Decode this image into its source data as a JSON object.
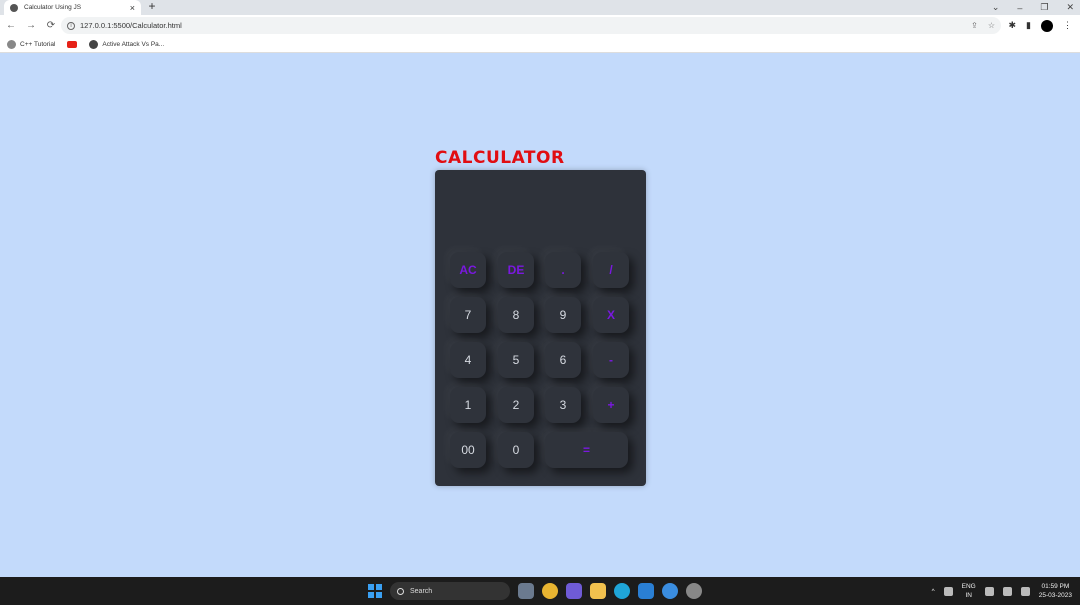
{
  "browser": {
    "tab_title": "Calculator Using JS",
    "tab_close": "×",
    "new_tab": "+",
    "window_controls": {
      "collapse": "⌄",
      "minimize": "–",
      "restore": "❐",
      "close": "✕"
    },
    "nav": {
      "back": "←",
      "forward": "→",
      "reload": "⟳"
    },
    "url": "127.0.0.1:5500/Calculator.html",
    "bookmarks": [
      "C++ Tutorial",
      "Active Attack Vs Pa..."
    ]
  },
  "calculator": {
    "title": "CALCULATOR",
    "display_value": "",
    "rows": [
      [
        {
          "label": "AC",
          "type": "op"
        },
        {
          "label": "DE",
          "type": "op"
        },
        {
          "label": ".",
          "type": "op"
        },
        {
          "label": "/",
          "type": "op"
        }
      ],
      [
        {
          "label": "7",
          "type": "num"
        },
        {
          "label": "8",
          "type": "num"
        },
        {
          "label": "9",
          "type": "num"
        },
        {
          "label": "X",
          "type": "op"
        }
      ],
      [
        {
          "label": "4",
          "type": "num"
        },
        {
          "label": "5",
          "type": "num"
        },
        {
          "label": "6",
          "type": "num"
        },
        {
          "label": "-",
          "type": "op"
        }
      ],
      [
        {
          "label": "1",
          "type": "num"
        },
        {
          "label": "2",
          "type": "num"
        },
        {
          "label": "3",
          "type": "num"
        },
        {
          "label": "+",
          "type": "op"
        }
      ],
      [
        {
          "label": "00",
          "type": "num"
        },
        {
          "label": "0",
          "type": "num"
        },
        {
          "label": "=",
          "type": "op",
          "wide": true
        }
      ]
    ],
    "colors": {
      "title": "#e10d12",
      "operator": "#7a18e0",
      "body": "#2e323a",
      "page_bg": "#c3dafb"
    }
  },
  "taskbar": {
    "search_placeholder": "Search",
    "language": "ENG",
    "region": "IN",
    "time": "01:59 PM",
    "date": "25-03-2023"
  }
}
